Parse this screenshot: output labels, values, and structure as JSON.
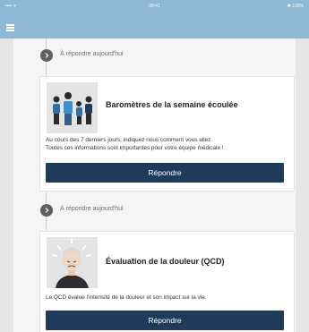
{
  "status_bar": {
    "carrier": "•••• ᯤ",
    "time": "08:41",
    "battery": "✱ 100%"
  },
  "nav": {
    "menu_icon": "hamburger-menu-icon"
  },
  "timeline": [
    {
      "header": "À répondre aujourd'hui",
      "header_icon": "chevron-right-icon",
      "card": {
        "illustration": "family-illustration",
        "title": "Baromètres de la semaine écoulée",
        "description_line1": "Au cours des 7 derniers jours, indiquez nous comment vous allez.",
        "description_line2": "Toutes ces informations sont importantes pour votre équipe médicale !",
        "button": "Répondre"
      }
    },
    {
      "header": "À répondre aujourd'hui",
      "header_icon": "chevron-right-icon",
      "card": {
        "illustration": "person-in-pain-illustration",
        "title": "Évaluation de la douleur (QCD)",
        "description_line1": "Le QCD évalue l'intensité de la douleur et son impact sur la vie.",
        "button": "Répondre"
      }
    }
  ],
  "colors": {
    "nav": "#8fb8d4",
    "button": "#1f3a5b",
    "timeline_circle": "#5f5f5f"
  }
}
